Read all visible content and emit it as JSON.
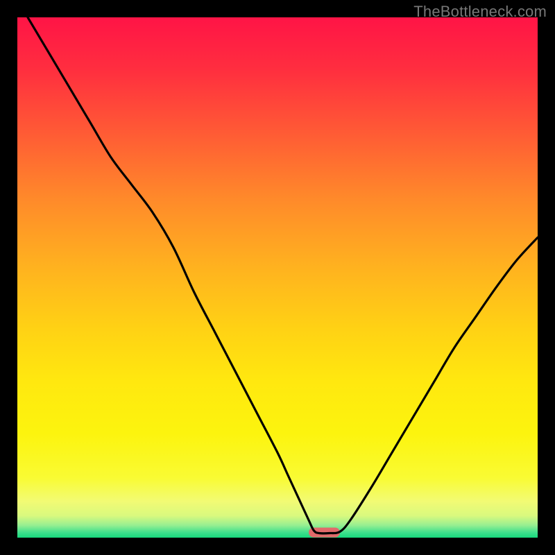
{
  "watermark": "TheBottleneck.com",
  "chart_data": {
    "type": "line",
    "title": "",
    "xlabel": "",
    "ylabel": "",
    "xlim": [
      0,
      100
    ],
    "ylim": [
      0,
      104
    ],
    "series": [
      {
        "name": "bottleneck-curve",
        "x": [
          2,
          6,
          10,
          14,
          18,
          22,
          26,
          30,
          34,
          38,
          42,
          46,
          50,
          52,
          54,
          56,
          57,
          58,
          60,
          62,
          64,
          68,
          72,
          76,
          80,
          84,
          88,
          92,
          96,
          100
        ],
        "values": [
          104,
          97,
          90,
          83,
          76,
          70.5,
          65,
          58,
          49,
          41,
          33,
          25,
          17,
          12.5,
          8,
          3.5,
          1.4,
          0.9,
          0.9,
          1.2,
          3.5,
          10,
          17,
          24,
          31,
          38,
          44,
          50,
          55.5,
          60
        ]
      }
    ],
    "optimum_marker": {
      "x_start": 56,
      "x_end": 62,
      "color": "#e26a6a"
    },
    "gradient_stops": [
      {
        "offset": 0.0,
        "color": "#ff1446"
      },
      {
        "offset": 0.1,
        "color": "#ff2e3f"
      },
      {
        "offset": 0.22,
        "color": "#ff5a35"
      },
      {
        "offset": 0.35,
        "color": "#ff8a2a"
      },
      {
        "offset": 0.48,
        "color": "#ffb21f"
      },
      {
        "offset": 0.6,
        "color": "#ffd214"
      },
      {
        "offset": 0.7,
        "color": "#ffe80f"
      },
      {
        "offset": 0.8,
        "color": "#fcf40e"
      },
      {
        "offset": 0.885,
        "color": "#f9fb33"
      },
      {
        "offset": 0.93,
        "color": "#f2fb74"
      },
      {
        "offset": 0.958,
        "color": "#d9f97e"
      },
      {
        "offset": 0.976,
        "color": "#98ef91"
      },
      {
        "offset": 0.99,
        "color": "#3fe08d"
      },
      {
        "offset": 1.0,
        "color": "#17d87d"
      }
    ]
  }
}
